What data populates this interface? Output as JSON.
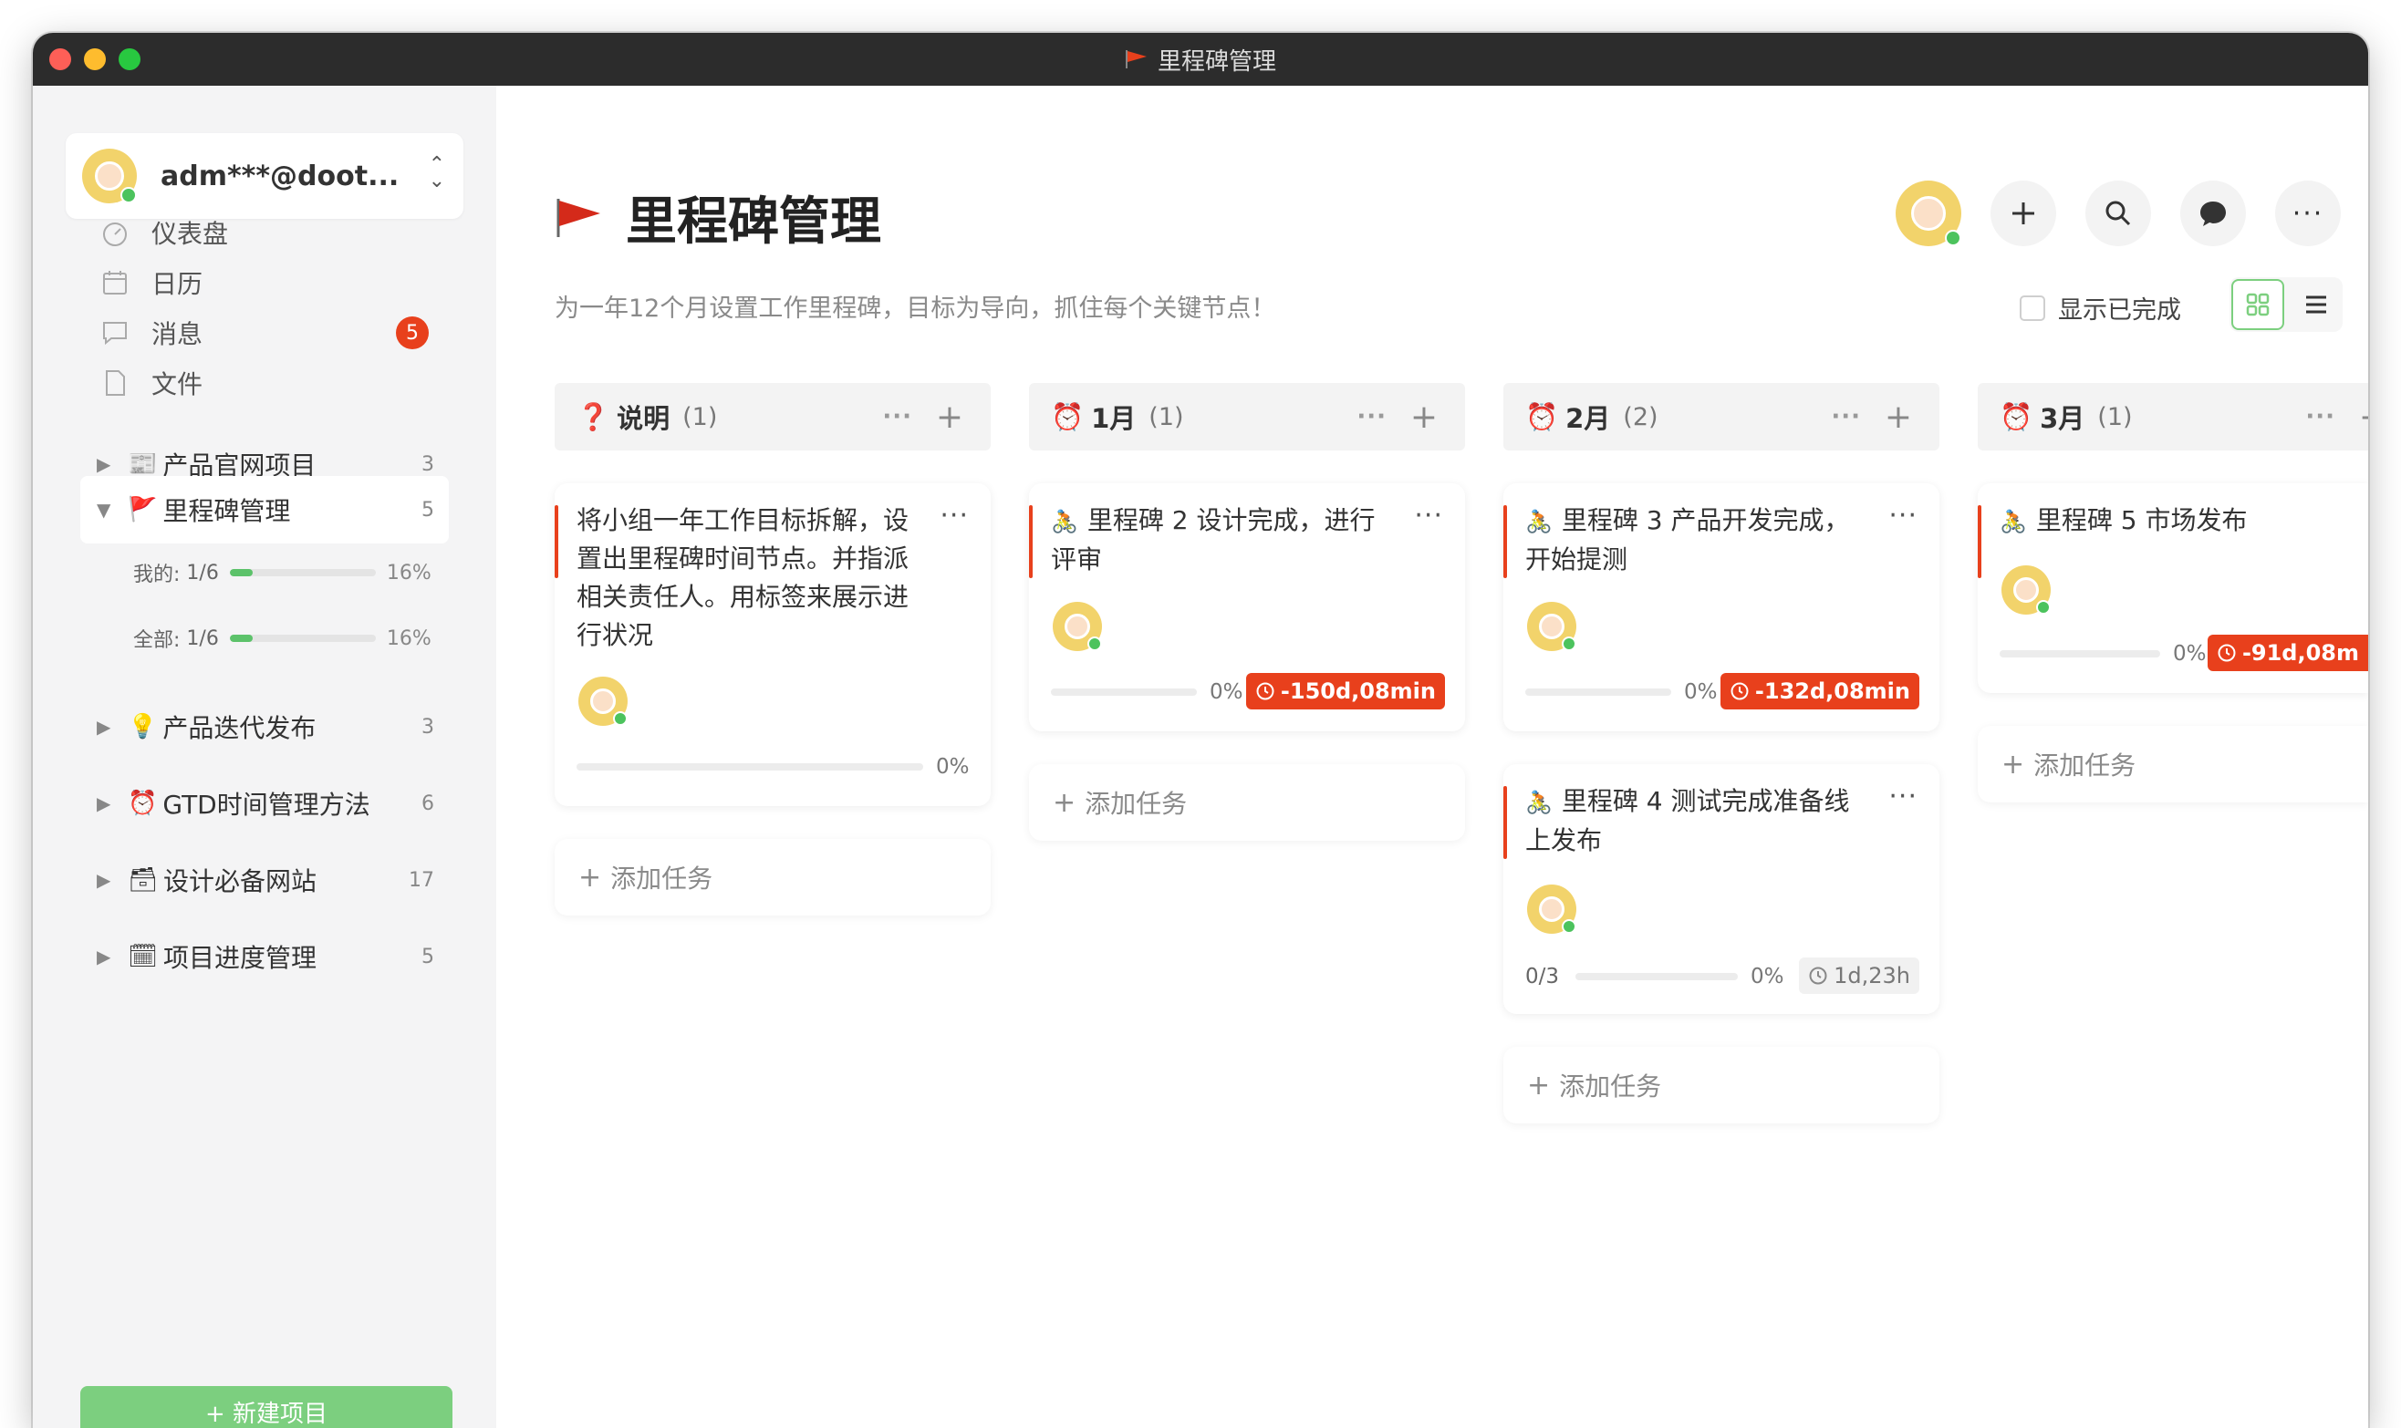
{
  "window": {
    "title": "里程碑管理"
  },
  "account": {
    "name": "adm***@doot..."
  },
  "nav": [
    {
      "label": "仪表盘",
      "icon": "dashboard-icon"
    },
    {
      "label": "日历",
      "icon": "calendar-icon"
    },
    {
      "label": "消息",
      "icon": "message-icon",
      "badge": "5"
    },
    {
      "label": "文件",
      "icon": "file-icon"
    }
  ],
  "projects": [
    {
      "emoji": "📰",
      "label": "产品官网项目",
      "count": "3",
      "expanded": false
    },
    {
      "emoji": "🚩",
      "label": "里程碑管理",
      "count": "5",
      "expanded": true
    },
    {
      "emoji": "💡",
      "label": "产品迭代发布",
      "count": "3",
      "expanded": false
    },
    {
      "emoji": "⏰",
      "label": "GTD时间管理方法",
      "count": "6",
      "expanded": false
    },
    {
      "emoji": "🗃",
      "label": "设计必备网站",
      "count": "17",
      "expanded": false
    },
    {
      "emoji": "🗓",
      "label": "项目进度管理",
      "count": "5",
      "expanded": false
    }
  ],
  "stats": {
    "mine": {
      "label": "我的:",
      "value": "1/6",
      "pct": "16%",
      "fraction": 0.16
    },
    "all": {
      "label": "全部:",
      "value": "1/6",
      "pct": "16%",
      "fraction": 0.16
    }
  },
  "new_project": "+ 新建项目",
  "page": {
    "title": "里程碑管理",
    "subtitle": "为一年12个月设置工作里程碑，目标为导向，抓住每个关键节点！",
    "show_done": "显示已完成"
  },
  "header_buttons": [
    "add-icon",
    "search-icon",
    "chat-icon",
    "more-icon"
  ],
  "columns": [
    {
      "icon": "❓",
      "title": "说明",
      "count": "(1)"
    },
    {
      "icon": "⏰",
      "title": "1月",
      "count": "(1)"
    },
    {
      "icon": "⏰",
      "title": "2月",
      "count": "(2)"
    },
    {
      "icon": "⏰",
      "title": "3月",
      "count": "(1)"
    }
  ],
  "cards": [
    {
      "text": "将小组一年工作目标拆解，设置出里程碑时间节点。并指派相关责任人。用标签来展示进行状况",
      "progress": "0%",
      "progress_value": 0
    },
    {
      "text": "里程碑 2 设计完成，进行评审",
      "progress": "0%",
      "progress_value": 0,
      "due": "-150d,08min"
    },
    {
      "text": "里程碑 3 产品开发完成，开始提测",
      "progress": "0%",
      "progress_value": 0,
      "due": "-132d,08min"
    },
    {
      "text": "里程碑 4 测试完成准备线上发布",
      "subtasks": "0/3",
      "progress": "0%",
      "progress_value": 0,
      "due": "1d,23h"
    },
    {
      "text": "里程碑 5 市场发布",
      "progress": "0%",
      "progress_value": 0,
      "due": "-91d,08m"
    }
  ],
  "add_task": "添加任务",
  "colors": {
    "accent": "#e8401c",
    "green": "#7ccf7f",
    "progress": "#5cc26a"
  }
}
